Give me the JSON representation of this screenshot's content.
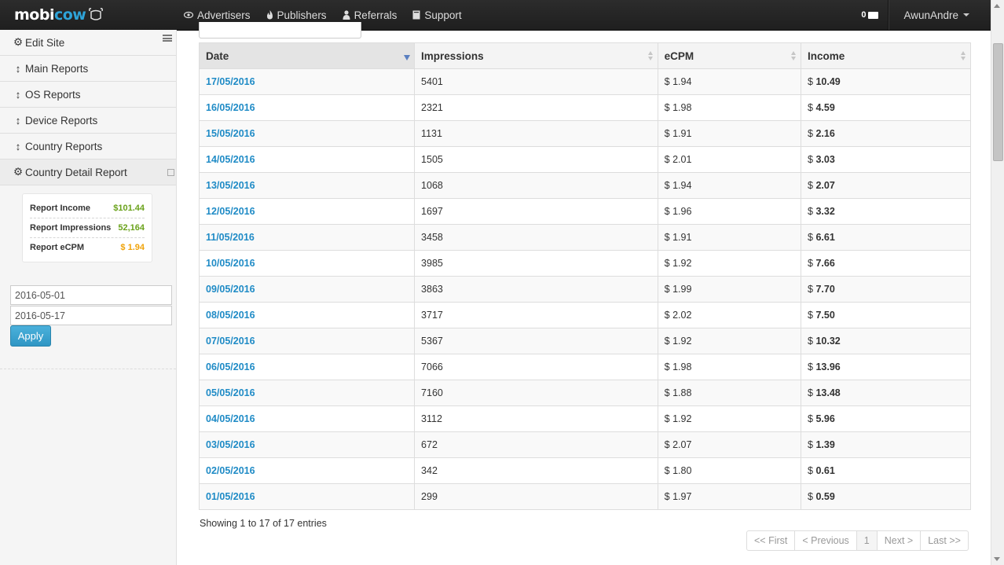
{
  "brand": {
    "name_prefix": "mobi",
    "name_accent": "cow"
  },
  "nav": {
    "links": [
      "Advertisers",
      "Publishers",
      "Referrals",
      "Support"
    ],
    "messages_count": "0",
    "user": "AwunAndre"
  },
  "sidebar": {
    "items": [
      {
        "label": "Edit Site",
        "icon": "gear-icon"
      },
      {
        "label": "Main Reports",
        "icon": "updown-arrow-icon"
      },
      {
        "label": "OS Reports",
        "icon": "updown-arrow-icon"
      },
      {
        "label": "Device Reports",
        "icon": "updown-arrow-icon"
      },
      {
        "label": "Country Reports",
        "icon": "updown-arrow-icon"
      },
      {
        "label": "Country Detail Report",
        "icon": "gear-icon"
      }
    ],
    "stats": [
      {
        "label": "Report Income",
        "value": "$101.44",
        "color": "#6aa21b"
      },
      {
        "label": "Report Impressions",
        "value": "52,164",
        "color": "#6aa21b"
      },
      {
        "label": "Report eCPM",
        "value": "$ 1.94",
        "color": "#f0a30a"
      }
    ],
    "date_from": "2016-05-01",
    "date_to": "2016-05-17",
    "apply_label": "Apply"
  },
  "table": {
    "headers": [
      "Date",
      "Impressions",
      "eCPM",
      "Income"
    ],
    "rows": [
      {
        "date": "17/05/2016",
        "impressions": "5401",
        "ecpm": "$ 1.94",
        "income_prefix": "$",
        "income": "10.49"
      },
      {
        "date": "16/05/2016",
        "impressions": "2321",
        "ecpm": "$ 1.98",
        "income_prefix": "$",
        "income": "4.59"
      },
      {
        "date": "15/05/2016",
        "impressions": "1131",
        "ecpm": "$ 1.91",
        "income_prefix": "$",
        "income": "2.16"
      },
      {
        "date": "14/05/2016",
        "impressions": "1505",
        "ecpm": "$ 2.01",
        "income_prefix": "$",
        "income": "3.03"
      },
      {
        "date": "13/05/2016",
        "impressions": "1068",
        "ecpm": "$ 1.94",
        "income_prefix": "$",
        "income": "2.07"
      },
      {
        "date": "12/05/2016",
        "impressions": "1697",
        "ecpm": "$ 1.96",
        "income_prefix": "$",
        "income": "3.32"
      },
      {
        "date": "11/05/2016",
        "impressions": "3458",
        "ecpm": "$ 1.91",
        "income_prefix": "$",
        "income": "6.61"
      },
      {
        "date": "10/05/2016",
        "impressions": "3985",
        "ecpm": "$ 1.92",
        "income_prefix": "$",
        "income": "7.66"
      },
      {
        "date": "09/05/2016",
        "impressions": "3863",
        "ecpm": "$ 1.99",
        "income_prefix": "$",
        "income": "7.70"
      },
      {
        "date": "08/05/2016",
        "impressions": "3717",
        "ecpm": "$ 2.02",
        "income_prefix": "$",
        "income": "7.50"
      },
      {
        "date": "07/05/2016",
        "impressions": "5367",
        "ecpm": "$ 1.92",
        "income_prefix": "$",
        "income": "10.32"
      },
      {
        "date": "06/05/2016",
        "impressions": "7066",
        "ecpm": "$ 1.98",
        "income_prefix": "$",
        "income": "13.96"
      },
      {
        "date": "05/05/2016",
        "impressions": "7160",
        "ecpm": "$ 1.88",
        "income_prefix": "$",
        "income": "13.48"
      },
      {
        "date": "04/05/2016",
        "impressions": "3112",
        "ecpm": "$ 1.92",
        "income_prefix": "$",
        "income": "5.96"
      },
      {
        "date": "03/05/2016",
        "impressions": "672",
        "ecpm": "$ 2.07",
        "income_prefix": "$",
        "income": "1.39"
      },
      {
        "date": "02/05/2016",
        "impressions": "342",
        "ecpm": "$ 1.80",
        "income_prefix": "$",
        "income": "0.61"
      },
      {
        "date": "01/05/2016",
        "impressions": "299",
        "ecpm": "$ 1.97",
        "income_prefix": "$",
        "income": "0.59"
      }
    ],
    "info": "Showing 1 to 17 of 17 entries"
  },
  "pagination": [
    "<< First",
    "< Previous",
    "1",
    "Next >",
    "Last >>"
  ],
  "colors": {
    "link": "#1f8bc6",
    "accent": "#2ea3d8",
    "apply": "#3aa2cf"
  }
}
